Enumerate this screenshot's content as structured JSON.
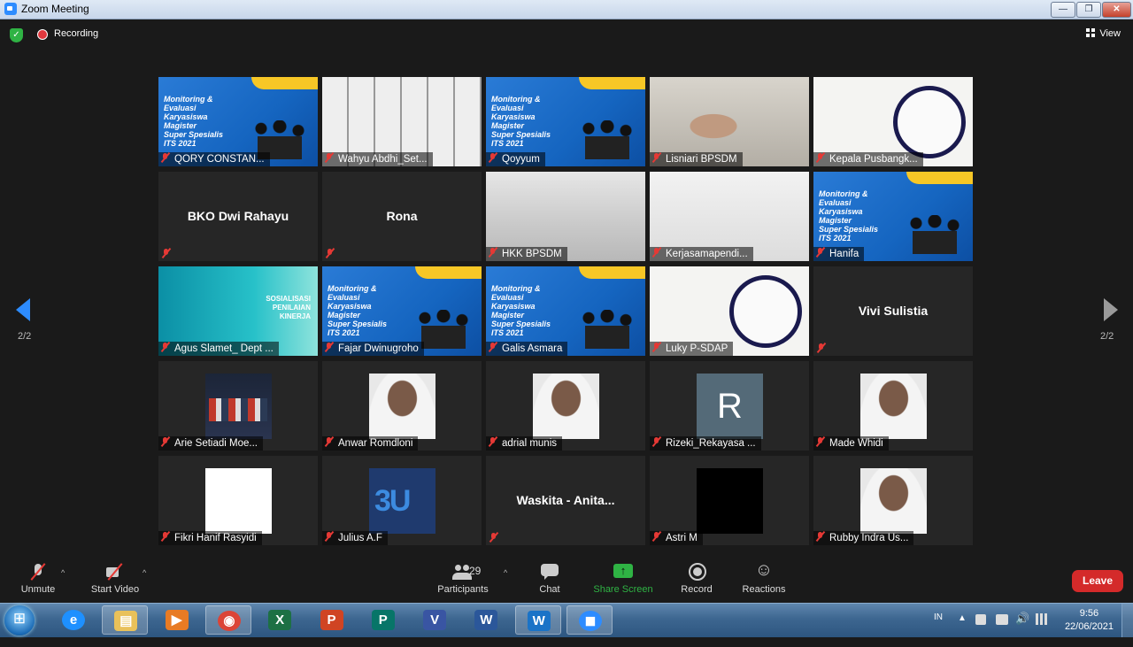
{
  "window": {
    "title": "Zoom Meeting",
    "controls": {
      "minimize": "—",
      "maximize": "❐",
      "close": "✕"
    }
  },
  "topbar": {
    "recording_label": "Recording",
    "view_label": "View"
  },
  "pagination": {
    "left_indicator": "2/2",
    "right_indicator": "2/2"
  },
  "tiles": [
    {
      "name": "QORY CONSTAN...",
      "visual": "banner"
    },
    {
      "name": "Wahyu Abdhi_Set...",
      "visual": "shelf"
    },
    {
      "name": "Qoyyum",
      "visual": "banner"
    },
    {
      "name": "Lisniari BPSDM",
      "visual": "face"
    },
    {
      "name": "Kepala Pusbangk...",
      "visual": "pusbang"
    },
    {
      "name": "BKO Dwi Rahayu",
      "visual": "name-only"
    },
    {
      "name": "Rona",
      "visual": "name-only"
    },
    {
      "name": "HKK BPSDM",
      "visual": "room",
      "active": true
    },
    {
      "name": "Kerjasamapendi...",
      "visual": "white"
    },
    {
      "name": "Hanifa",
      "visual": "banner"
    },
    {
      "name": "Agus Slamet_ Dept ...",
      "visual": "teal"
    },
    {
      "name": "Fajar Dwinugroho",
      "visual": "banner"
    },
    {
      "name": "Galis Asmara",
      "visual": "banner"
    },
    {
      "name": "Luky P-SDAP",
      "visual": "pusbang"
    },
    {
      "name": "Vivi Sulistia",
      "visual": "name-only"
    },
    {
      "name": "Arie Setiadi Moe...",
      "visual": "thumb-dark"
    },
    {
      "name": "Anwar Romdloni",
      "visual": "thumb-headshot"
    },
    {
      "name": "adrial munis",
      "visual": "thumb-headshot"
    },
    {
      "name": "Rizeki_Rekayasa ...",
      "visual": "thumb-letter",
      "letter": "R"
    },
    {
      "name": "Made Whidi",
      "visual": "thumb-headshot"
    },
    {
      "name": "Fikri Hanif Rasyidi",
      "visual": "thumb-blank"
    },
    {
      "name": "Julius A.F",
      "visual": "thumb-poster"
    },
    {
      "name": "Waskita - Anita...",
      "visual": "name-only"
    },
    {
      "name": "Astri M",
      "visual": "thumb-black"
    },
    {
      "name": "Rubby Indra Us...",
      "visual": "thumb-headshot"
    }
  ],
  "banner_text": "Monitoring &\nEvaluasi\nKaryasiswa\nMagister\nSuper Spesialis\nITS 2021",
  "teal_text": "SOSIALISASI\nPENILAIAN\nKINERJA",
  "toolbar": {
    "unmute": "Unmute",
    "start_video": "Start Video",
    "participants": "Participants",
    "participants_count": "29",
    "chat": "Chat",
    "share_screen": "Share Screen",
    "record": "Record",
    "reactions": "Reactions",
    "leave": "Leave",
    "caret": "^"
  },
  "taskbar": {
    "apps": [
      "ie-icon",
      "explorer-icon",
      "media-player-icon",
      "chrome-icon",
      "excel-icon",
      "powerpoint-icon",
      "publisher-icon",
      "visio-icon",
      "word-icon",
      "writer-icon",
      "zoom-icon"
    ],
    "language": "IN",
    "time": "9:56",
    "date": "22/06/2021"
  },
  "colors": {
    "accent": "#2d8cff",
    "share_green": "#2fb344",
    "leave_red": "#d42a2a",
    "active_speaker": "#e6e63a"
  }
}
